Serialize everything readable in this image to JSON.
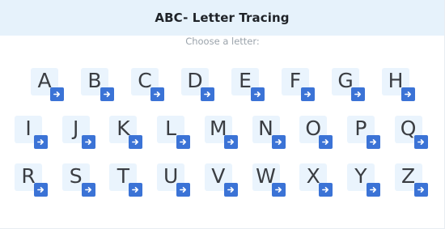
{
  "header": {
    "title": "ABC- Letter Tracing",
    "background": "#e6f2fb"
  },
  "prompt": "Choose a letter:",
  "button_icon": "arrow-right-icon",
  "accent": "#3b73d6",
  "tile_color": "#eaf4fd",
  "rows": [
    [
      "A",
      "B",
      "C",
      "D",
      "E",
      "F",
      "G",
      "H"
    ],
    [
      "I",
      "J",
      "K",
      "L",
      "M",
      "N",
      "O",
      "P",
      "Q"
    ],
    [
      "R",
      "S",
      "T",
      "U",
      "V",
      "W",
      "X",
      "Y",
      "Z"
    ]
  ]
}
